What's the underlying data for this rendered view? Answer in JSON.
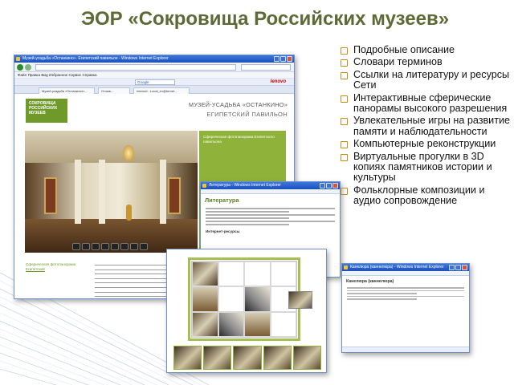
{
  "slide": {
    "title": "ЭОР «Сокровища Российских музеев»"
  },
  "bullets": [
    "Подробные  описание",
    "Словари терминов",
    "Ссылки на литературу и ресурсы Сети",
    "Интерактивные сферические панорамы высокого разрешения",
    "Увлекательные игры на развитие памяти и наблюдательности",
    "Компьютерные реконструкции",
    "Виртуальные прогулки в 3D копиях памятников истории и культуры",
    "Фольклорные композиции и аудио сопровождение"
  ],
  "main_window": {
    "title": "Музей-усадьба «Останкино». Египетский павильон - Windows Internet Explorer",
    "menu": "Файл  Правка  Вид  Избранное  Сервис  Справка",
    "search_engine": "Google",
    "toolbar_brand": "lenovo",
    "tabs": [
      "Музей-усадьба «Останкино»...",
      "Отзыв...",
      "Internet : Local_ex@ternet..."
    ],
    "logo_lines": [
      "СОКРОВИЩА",
      "РОССИЙСКИХ",
      "МУЗЕЕВ"
    ],
    "museum_name": "МУЗЕЙ-УСАДЬБА «ОСТАНКИНО»",
    "pavilion": "ЕГИПЕТСКИЙ ПАВИЛЬОН",
    "green_panel_text": "Сферическая фотопанорама Египетского павильона",
    "lower_left_text": "Сферическая фотопанорама",
    "lower_left_link": "Египетский"
  },
  "literature_window": {
    "title": "Литература - Windows Internet Explorer",
    "heading": "Литература",
    "subheading": "Интернет-ресурсы"
  },
  "kaneliura_window": {
    "title": "Канелюра (каннелюра) - Windows Internet Explorer",
    "heading": "Канелюра (каннелюра)"
  },
  "colors": {
    "title": "#5e6a36",
    "bullet_marker": "#c48a1c",
    "museum_green": "#8fb33a"
  }
}
